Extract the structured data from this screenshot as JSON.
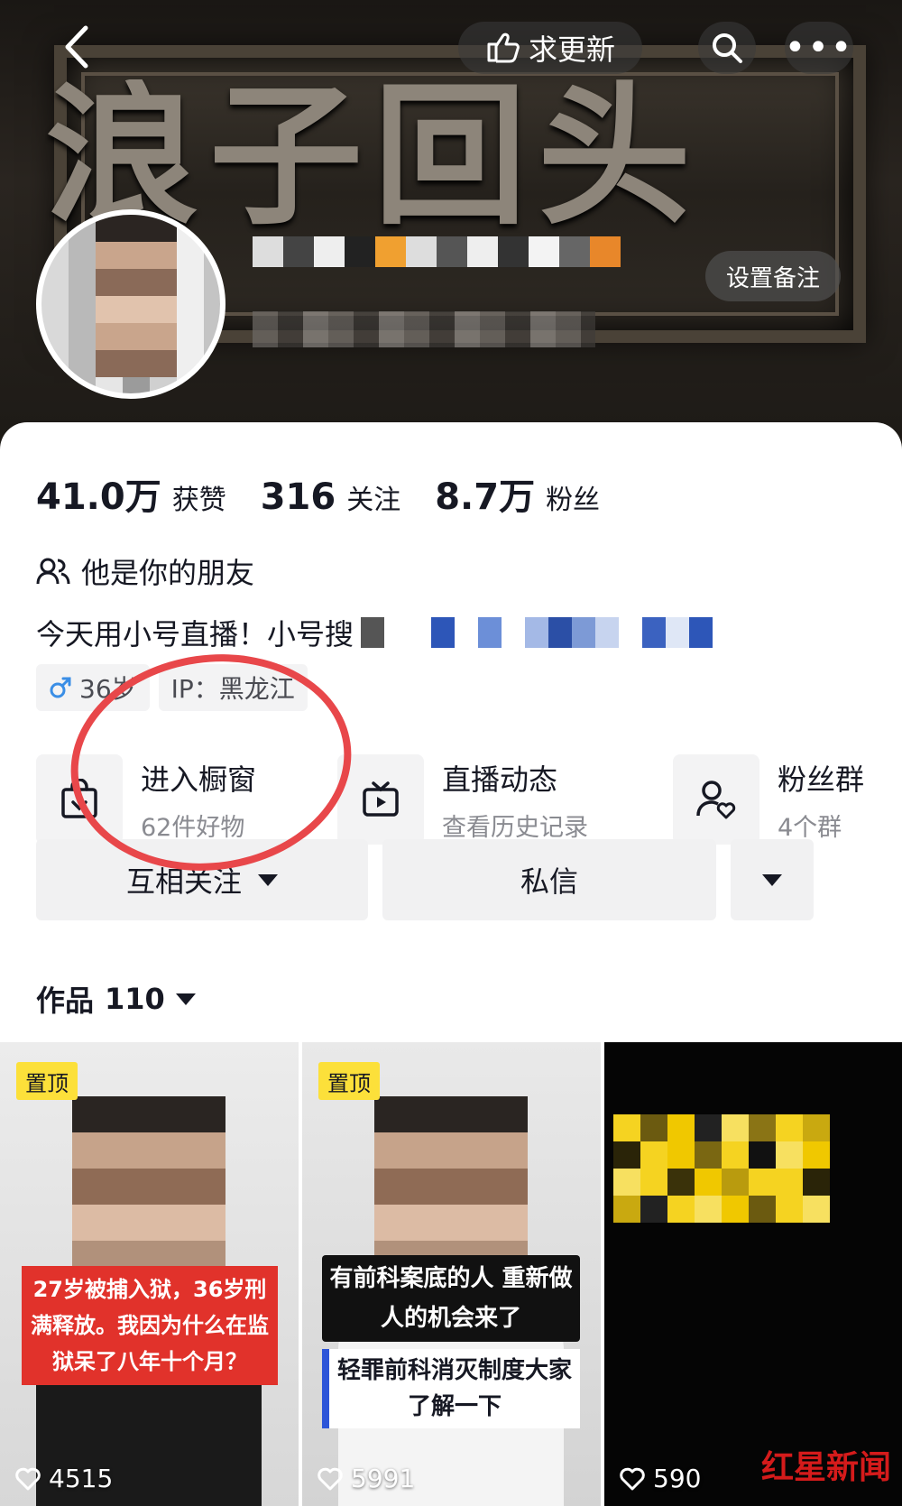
{
  "header": {
    "update_label": "求更新",
    "banner_text": "浪子回头",
    "remark_label": "设置备注"
  },
  "stats": {
    "likes_value": "41.0万",
    "likes_label": "获赞",
    "following_value": "316",
    "following_label": "关注",
    "fans_value": "8.7万",
    "fans_label": "粉丝"
  },
  "profile": {
    "friend_text": "他是你的朋友",
    "bio": "今天用小号直播！小号搜",
    "age": "36岁",
    "ip": "IP：黑龙江"
  },
  "entries": [
    {
      "title": "进入橱窗",
      "sub": "62件好物",
      "icon": "shop-bag-icon"
    },
    {
      "title": "直播动态",
      "sub": "查看历史记录",
      "icon": "tv-icon"
    },
    {
      "title": "粉丝群",
      "sub": "4个群",
      "icon": "fan-group-icon"
    }
  ],
  "actions": {
    "follow_label": "互相关注",
    "message_label": "私信"
  },
  "works": {
    "label": "作品",
    "count": "110"
  },
  "videos": [
    {
      "pinned": "置顶",
      "caption": "27岁被捕入狱，36岁刑满释放。我因为什么在监狱呆了八年十个月？",
      "likes": "4515"
    },
    {
      "pinned": "置顶",
      "caption_top": "有前科案底的人 重新做人的机会来了",
      "caption_bottom": "轻罪前科消灭制度大家了解一下",
      "likes": "5991"
    },
    {
      "likes": "590"
    }
  ],
  "watermark": "红星新闻",
  "colors": {
    "accent_red": "#e8474a",
    "pin_yellow": "#fce03a",
    "male_blue": "#3a8ee6"
  }
}
